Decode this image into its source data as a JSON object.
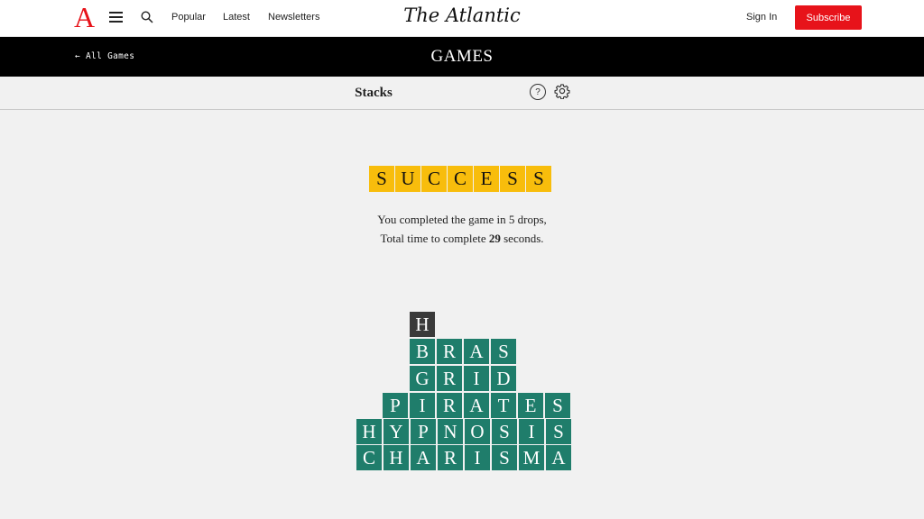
{
  "nav": {
    "logo": "A",
    "links": [
      "Popular",
      "Latest",
      "Newsletters"
    ],
    "brand": "The Atlantic",
    "signin": "Sign In",
    "subscribe": "Subscribe"
  },
  "gamesbar": {
    "back": "← All Games",
    "title": "GAMES"
  },
  "subheader": {
    "title": "Stacks",
    "help": "?"
  },
  "result": {
    "word": [
      "S",
      "U",
      "C",
      "C",
      "E",
      "S",
      "S"
    ],
    "line1": "You completed the game in 5 drops,",
    "line2_prefix": "Total time to complete ",
    "line2_value": "29",
    "line2_suffix": " seconds."
  },
  "stack": [
    {
      "letters": [
        "H"
      ],
      "style": "dark"
    },
    {
      "letters": [
        "B",
        "R",
        "A",
        "S"
      ],
      "style": "green"
    },
    {
      "letters": [
        "G",
        "R",
        "I",
        "D"
      ],
      "style": "green"
    },
    {
      "letters": [
        "P",
        "I",
        "R",
        "A",
        "T",
        "E",
        "S"
      ],
      "style": "green"
    },
    {
      "letters": [
        "H",
        "Y",
        "P",
        "N",
        "O",
        "S",
        "I",
        "S"
      ],
      "style": "green"
    },
    {
      "letters": [
        "C",
        "H",
        "A",
        "R",
        "I",
        "S",
        "M",
        "A"
      ],
      "style": "green"
    }
  ],
  "colors": {
    "accent_red": "#e7131a",
    "success_tile": "#f8bd0c",
    "stack_tile": "#1f7d6b",
    "falling_tile": "#3a3a3a"
  }
}
